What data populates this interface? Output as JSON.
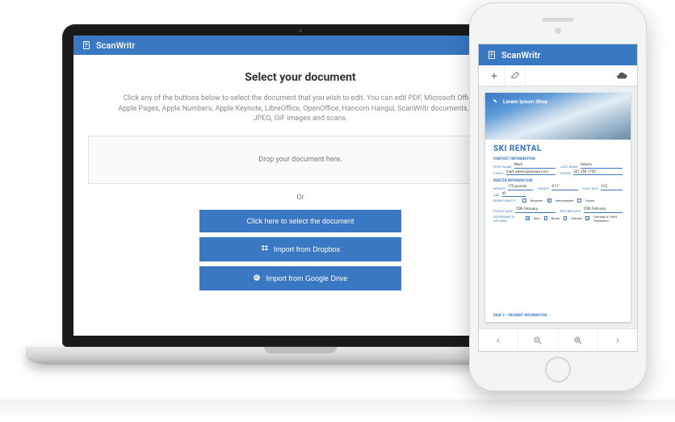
{
  "colors": {
    "accent": "#3a78c3"
  },
  "laptop": {
    "app_name": "ScanWritr",
    "title": "Select your document",
    "description": "Click any of the buttons below to select the document that you wish to edit. You can edit PDF, Microsoft Office, Apple Pages, Apple Numbers, Apple Keynote, LibreOffice, OpenOffice, Hancom Hangul, ScanWritr documents, and JPEG, GIF images and scans.",
    "dropzone_label": "Drop your document here.",
    "or_label": "Or",
    "buttons": {
      "select": "Click here to select the document",
      "dropbox": "Import from Dropbox",
      "gdrive": "Import from Google Drive"
    }
  },
  "phone": {
    "app_name": "ScanWritr",
    "doc": {
      "shop_name": "Lorem Ipsum Shop",
      "title": "SKI RENTAL",
      "contact": {
        "section_label": "CONTACT INFORMATION:",
        "first_name_label": "FIRST NAME",
        "first_name": "Mark",
        "last_name_label": "LAST NAME",
        "last_name": "Adams",
        "email_label": "E-MAIL",
        "email": "mark.adams@vanaia.com",
        "phone_label": "PHONE",
        "phone": "347 354 1750"
      },
      "renter": {
        "section_label": "RENTER INFORMATION:",
        "weight_label": "WEIGHT",
        "weight": "175 pounds",
        "height_label": "HEIGHT",
        "height": "6'11\"",
        "foot_label": "FOOT SIZE",
        "foot": "10,5",
        "age_label": "AGE",
        "age": "45",
        "ability_label": "SKIING ABILITY",
        "ability_opts": [
          "Beginner",
          "Intermediate",
          "Expert"
        ],
        "ability_selected": 1
      },
      "rental": {
        "pickup_label": "PICKUP DATE",
        "pickup": "15th February",
        "return_label": "RETURN DATE",
        "return": "25th February",
        "equip_label": "EQUIPMENT & OPTIONS",
        "equip_opts": [
          "Skis",
          "Boots",
          "Helmet",
          "Damage & Theft Protection"
        ],
        "equip_selected": [
          0,
          3
        ]
      },
      "footer": "PAGE 2 – PAYMENT INFORMATION   →"
    }
  }
}
